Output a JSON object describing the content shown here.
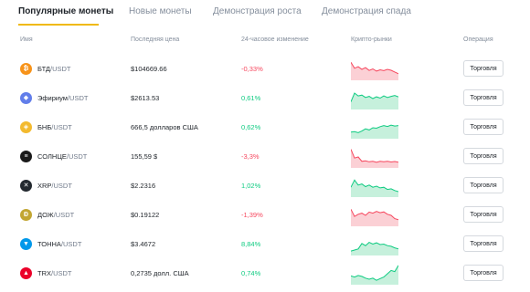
{
  "tabs": [
    {
      "label": "Популярные монеты",
      "active": true
    },
    {
      "label": "Новые монеты",
      "active": false
    },
    {
      "label": "Демонстрация роста",
      "active": false
    },
    {
      "label": "Демонстрация спада",
      "active": false
    }
  ],
  "columns": {
    "name": "Имя",
    "price": "Последняя цена",
    "change": "24-часовое изменение",
    "markets": "Крипто-рынки",
    "operation": "Операция"
  },
  "colors": {
    "accent": "#f0b90b",
    "up": "#0ecb81",
    "down": "#f6465d",
    "up_fill": "#c6f0dc",
    "down_fill": "#fbd0d5"
  },
  "rows": [
    {
      "base": "БТД",
      "quote": "/USDT",
      "price": "$104669.66",
      "change": "-0,33%",
      "direction": "down",
      "icon": "bitcoin-icon",
      "icon_glyph": "₿",
      "icon_color": "#f7931a",
      "trend": [
        0.82,
        0.55,
        0.62,
        0.5,
        0.58,
        0.45,
        0.52,
        0.42,
        0.48,
        0.44,
        0.5,
        0.46,
        0.38,
        0.3
      ]
    },
    {
      "base": "Эфириум",
      "quote": "/USDT",
      "price": "$2613.53",
      "change": "0,61%",
      "direction": "up",
      "icon": "ethereum-icon",
      "icon_glyph": "◆",
      "icon_color": "#627eea",
      "trend": [
        0.35,
        0.75,
        0.62,
        0.66,
        0.55,
        0.6,
        0.5,
        0.58,
        0.52,
        0.62,
        0.55,
        0.6,
        0.64,
        0.58
      ]
    },
    {
      "base": "БНБ",
      "quote": "/USDT",
      "price": "666,5 долларов США",
      "change": "0,62%",
      "direction": "up",
      "icon": "bnb-icon",
      "icon_glyph": "◈",
      "icon_color": "#f3ba2f",
      "trend": [
        0.3,
        0.32,
        0.28,
        0.35,
        0.45,
        0.4,
        0.5,
        0.48,
        0.55,
        0.6,
        0.56,
        0.62,
        0.58,
        0.6
      ]
    },
    {
      "base": "СОЛНЦЕ",
      "quote": "/USDT",
      "price": "155,59 $",
      "change": "-3,3%",
      "direction": "down",
      "icon": "solana-icon",
      "icon_glyph": "≡",
      "icon_color": "#1a1a1a",
      "trend": [
        0.85,
        0.45,
        0.5,
        0.3,
        0.32,
        0.28,
        0.3,
        0.26,
        0.3,
        0.28,
        0.3,
        0.27,
        0.29,
        0.26
      ]
    },
    {
      "base": "XRP",
      "quote": "/USDT",
      "price": "$2.2316",
      "change": "1,02%",
      "direction": "up",
      "icon": "xrp-icon",
      "icon_glyph": "✕",
      "icon_color": "#23292f",
      "trend": [
        0.45,
        0.78,
        0.55,
        0.6,
        0.48,
        0.55,
        0.45,
        0.5,
        0.42,
        0.45,
        0.35,
        0.38,
        0.3,
        0.25
      ]
    },
    {
      "base": "ДОЖ",
      "quote": "/USDT",
      "price": "$0.19122",
      "change": "-1,39%",
      "direction": "down",
      "icon": "dogecoin-icon",
      "icon_glyph": "Ð",
      "icon_color": "#c2a633",
      "trend": [
        0.78,
        0.45,
        0.55,
        0.6,
        0.5,
        0.65,
        0.6,
        0.68,
        0.62,
        0.66,
        0.55,
        0.5,
        0.35,
        0.3
      ]
    },
    {
      "base": "ТОННА",
      "quote": "/USDT",
      "price": "$3.4672",
      "change": "8,84%",
      "direction": "up",
      "icon": "toncoin-icon",
      "icon_glyph": "▼",
      "icon_color": "#0098ea",
      "trend": [
        0.2,
        0.25,
        0.3,
        0.55,
        0.45,
        0.6,
        0.52,
        0.58,
        0.5,
        0.52,
        0.45,
        0.42,
        0.35,
        0.3
      ]
    },
    {
      "base": "TRX",
      "quote": "/USDT",
      "price": "0,2735 долл. США",
      "change": "0,74%",
      "direction": "up",
      "icon": "tron-icon",
      "icon_glyph": "▲",
      "icon_color": "#eb0029",
      "trend": [
        0.4,
        0.35,
        0.42,
        0.38,
        0.3,
        0.25,
        0.3,
        0.2,
        0.28,
        0.35,
        0.5,
        0.65,
        0.6,
        0.88
      ]
    }
  ],
  "trade_label": "Торговля"
}
